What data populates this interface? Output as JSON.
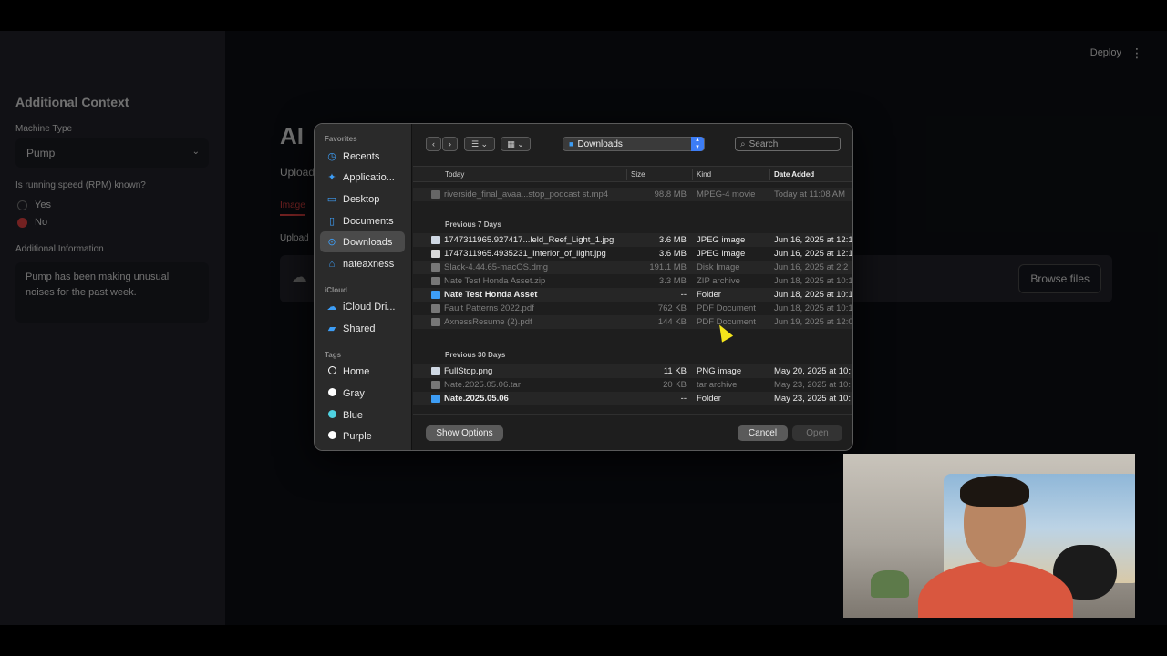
{
  "app": {
    "header": {
      "deploy_label": "Deploy",
      "menu_icon": "kebab-icon"
    },
    "sidebar": {
      "heading": "Additional Context",
      "machine_type_label": "Machine Type",
      "machine_type_value": "Pump",
      "rpm_label": "Is running speed (RPM) known?",
      "rpm_options": [
        "Yes",
        "No"
      ],
      "rpm_selected": "No",
      "info_label": "Additional Information",
      "info_value": "Pump has been making unusual noises for the past week."
    },
    "main": {
      "title": "AI",
      "subtitle": "Upload",
      "tab": "Image",
      "upload_label": "Upload",
      "browse_label": "Browse files"
    }
  },
  "dialog": {
    "sidebar": {
      "favorites_label": "Favorites",
      "favorites": [
        {
          "label": "Recents",
          "icon": "clock-icon"
        },
        {
          "label": "Applicatio...",
          "icon": "apps-icon"
        },
        {
          "label": "Desktop",
          "icon": "desktop-icon"
        },
        {
          "label": "Documents",
          "icon": "document-icon"
        },
        {
          "label": "Downloads",
          "icon": "download-icon",
          "selected": true
        },
        {
          "label": "nateaxness",
          "icon": "home-icon"
        }
      ],
      "icloud_label": "iCloud",
      "icloud": [
        {
          "label": "iCloud Dri...",
          "icon": "cloud-icon"
        },
        {
          "label": "Shared",
          "icon": "shared-folder-icon"
        }
      ],
      "tags_label": "Tags",
      "tags": [
        {
          "label": "Home",
          "color": "#1e1e1e",
          "outline": true
        },
        {
          "label": "Gray",
          "color": "#ffffff"
        },
        {
          "label": "Blue",
          "color": "#4fd1e0"
        },
        {
          "label": "Purple",
          "color": "#ffffff"
        }
      ]
    },
    "toolbar": {
      "location": "Downloads",
      "search_placeholder": "Search"
    },
    "columns": {
      "name": "Today",
      "size": "Size",
      "kind": "Kind",
      "date": "Date Added"
    },
    "groups": [
      {
        "label": "",
        "files": [
          {
            "name": "riverside_final_avaa...stop_podcast st.mp4",
            "size": "98.8 MB",
            "kind": "MPEG-4 movie",
            "date": "Today at 11:08 AM",
            "dim": true,
            "icon": "video"
          }
        ]
      },
      {
        "label": "Previous 7 Days",
        "files": [
          {
            "name": "1747311965.927417...leld_Reef_Light_1.jpg",
            "size": "3.6 MB",
            "kind": "JPEG image",
            "date": "Jun 16, 2025 at 12:1",
            "dim": false,
            "icon": "img"
          },
          {
            "name": "1747311965.4935231_Interior_of_light.jpg",
            "size": "3.6 MB",
            "kind": "JPEG image",
            "date": "Jun 16, 2025 at 12:1",
            "dim": false,
            "icon": "doc"
          },
          {
            "name": "Slack-4.44.65-macOS.dmg",
            "size": "191.1 MB",
            "kind": "Disk Image",
            "date": "Jun 16, 2025 at 2:2",
            "dim": true,
            "icon": "doc"
          },
          {
            "name": "Nate Test Honda Asset.zip",
            "size": "3.3 MB",
            "kind": "ZIP archive",
            "date": "Jun 18, 2025 at 10:1",
            "dim": true,
            "icon": "doc"
          },
          {
            "name": "Nate Test Honda Asset",
            "size": "--",
            "kind": "Folder",
            "date": "Jun 18, 2025 at 10:1",
            "dim": false,
            "icon": "folder"
          },
          {
            "name": "Fault Patterns 2022.pdf",
            "size": "762 KB",
            "kind": "PDF Document",
            "date": "Jun 18, 2025 at 10:1",
            "dim": true,
            "icon": "doc"
          },
          {
            "name": "AxnessResume (2).pdf",
            "size": "144 KB",
            "kind": "PDF Document",
            "date": "Jun 19, 2025 at 12:0",
            "dim": true,
            "icon": "doc"
          }
        ]
      },
      {
        "label": "Previous 30 Days",
        "files": [
          {
            "name": "FullStop.png",
            "size": "11 KB",
            "kind": "PNG image",
            "date": "May 20, 2025 at 10:",
            "dim": false,
            "icon": "img"
          },
          {
            "name": "Nate.2025.05.06.tar",
            "size": "20 KB",
            "kind": "tar archive",
            "date": "May 23, 2025 at 10:",
            "dim": true,
            "icon": "doc"
          },
          {
            "name": "Nate.2025.05.06",
            "size": "--",
            "kind": "Folder",
            "date": "May 23, 2025 at 10:",
            "dim": false,
            "icon": "folder"
          }
        ]
      }
    ],
    "footer": {
      "options_label": "Show Options",
      "cancel_label": "Cancel",
      "open_label": "Open"
    }
  }
}
